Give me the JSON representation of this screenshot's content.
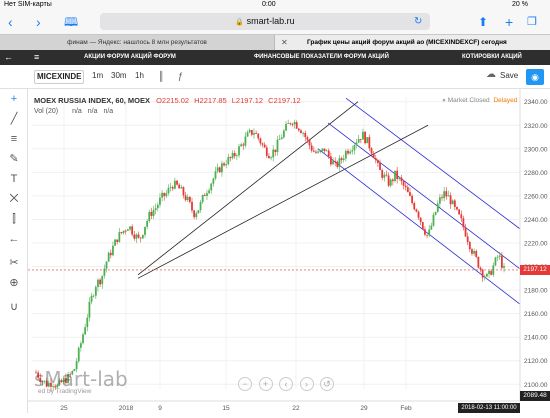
{
  "statusbar": {
    "carrier": "Нет SIM-карты",
    "time": "0:00",
    "battery": "20 %"
  },
  "browser": {
    "url": "smart-lab.ru",
    "tabs": [
      {
        "label": "финам — Яндекс: нашлось 8 млн результатов",
        "active": false
      },
      {
        "label": "График цены акций форум акций ао (MICEXINDEXCF) сегодня",
        "active": true
      }
    ]
  },
  "sitenav": {
    "items": [
      "АКЦИИ ФОРУМ АКЦИЙ ФОРУМ",
      "ФИНАНСОВЫЕ ПОКАЗАТЕЛИ ФОРУМ АКЦИЙ",
      "КОТИРОВКИ АКЦИЙ"
    ]
  },
  "chart_header": {
    "symbol": "MICEXINDE",
    "intervals": [
      "1m",
      "30m",
      "1h"
    ],
    "save_label": "Save"
  },
  "legend": {
    "title": "MOEX RUSSIA INDEX, 60, MOEX",
    "open": "O2215.02",
    "high": "H2217.85",
    "low": "L2197.12",
    "close": "C2197.12",
    "vol_label": "Vol (20)",
    "vol_values": [
      "n/a",
      "n/a",
      "n/a"
    ],
    "market_status": "Market Closed",
    "delayed": "Delayed"
  },
  "watermark": "sMart-lab",
  "tv_credit": "ed by TradingView",
  "colors": {
    "up": "#4caf50",
    "down": "#e53935",
    "channel_black": "#222222",
    "channel_blue": "#2b2bd6",
    "price_line": "#e53935"
  },
  "chart_data": {
    "type": "candlestick",
    "y_ticks": [
      2100,
      2120,
      2140,
      2160,
      2180,
      2200,
      2220,
      2240,
      2260,
      2280,
      2300,
      2320,
      2340
    ],
    "ylim": [
      2096,
      2344
    ],
    "x_ticks": [
      "25",
      "2018",
      "9",
      "15",
      "22",
      "29",
      "Feb"
    ],
    "last_price": "2197.12",
    "low_marker": "2089.48",
    "last_date": "2018-02-13 11:00:00",
    "trend": [
      2110,
      2104,
      2100,
      2102,
      2098,
      2103,
      2106,
      2112,
      2130,
      2150,
      2170,
      2185,
      2190,
      2205,
      2215,
      2225,
      2230,
      2235,
      2228,
      2222,
      2235,
      2245,
      2250,
      2258,
      2262,
      2270,
      2268,
      2262,
      2255,
      2245,
      2250,
      2262,
      2270,
      2278,
      2285,
      2290,
      2292,
      2298,
      2305,
      2312,
      2315,
      2308,
      2300,
      2295,
      2300,
      2310,
      2318,
      2325,
      2320,
      2315,
      2305,
      2298,
      2295,
      2300,
      2292,
      2285,
      2290,
      2298,
      2302,
      2308,
      2312,
      2305,
      2296,
      2282,
      2276,
      2270,
      2278,
      2272,
      2265,
      2255,
      2248,
      2235,
      2225,
      2240,
      2255,
      2262,
      2258,
      2248,
      2240,
      2228,
      2215,
      2205,
      2195,
      2190,
      2200,
      2210,
      2197
    ]
  }
}
